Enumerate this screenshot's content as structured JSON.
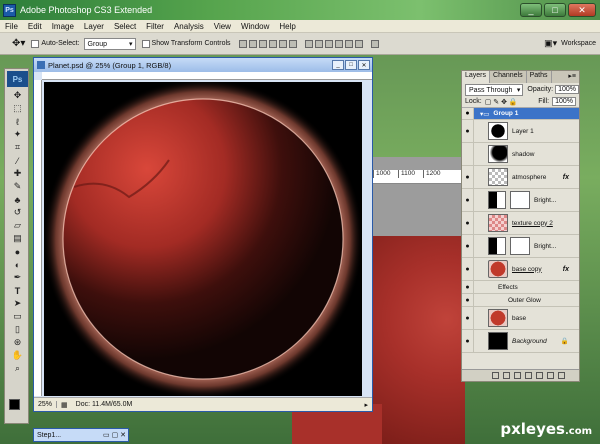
{
  "app": {
    "title": "Adobe Photoshop CS3 Extended",
    "logo": "Ps",
    "window_buttons": [
      "minimize-icon",
      "maximize-icon",
      "close-icon"
    ]
  },
  "menu": [
    "File",
    "Edit",
    "Image",
    "Layer",
    "Select",
    "Filter",
    "Analysis",
    "View",
    "Window",
    "Help"
  ],
  "options_bar": {
    "auto_select_label": "Auto-Select:",
    "auto_select_value": "Group",
    "show_transform_label": "Show Transform Controls",
    "workspace_label": "Workspace"
  },
  "document": {
    "title": "Planet.psd @ 25% (Group 1, RGB/8)",
    "zoom": "25%",
    "doc_info": "Doc: 11.4M/65.0M"
  },
  "background_ruler": [
    "1000",
    "1100",
    "1200"
  ],
  "layers_panel": {
    "tabs": [
      "Layers",
      "Channels",
      "Paths"
    ],
    "blend_mode": "Pass Through",
    "opacity_label": "Opacity:",
    "opacity_value": "100%",
    "lock_label": "Lock:",
    "fill_label": "Fill:",
    "fill_value": "100%",
    "layers": [
      {
        "name": "Group 1"
      },
      {
        "name": "Layer 1"
      },
      {
        "name": "shadow"
      },
      {
        "name": "atmosphere",
        "fx": "fx"
      },
      {
        "name": "Bright..."
      },
      {
        "name": "texture copy 2"
      },
      {
        "name": "Bright..."
      },
      {
        "name": "base copy",
        "fx": "fx"
      },
      {
        "name": "Effects"
      },
      {
        "name": "Outer Glow"
      },
      {
        "name": "base"
      },
      {
        "name": "Background"
      }
    ]
  },
  "taskbar": {
    "mini_doc": "Step1..."
  },
  "watermark": {
    "main": "pxleyes",
    "suffix": ".com"
  },
  "colors": {
    "title_bar": "#4e9a46",
    "selected_layer": "#3b73c8",
    "planet_red": "#c0392b"
  }
}
